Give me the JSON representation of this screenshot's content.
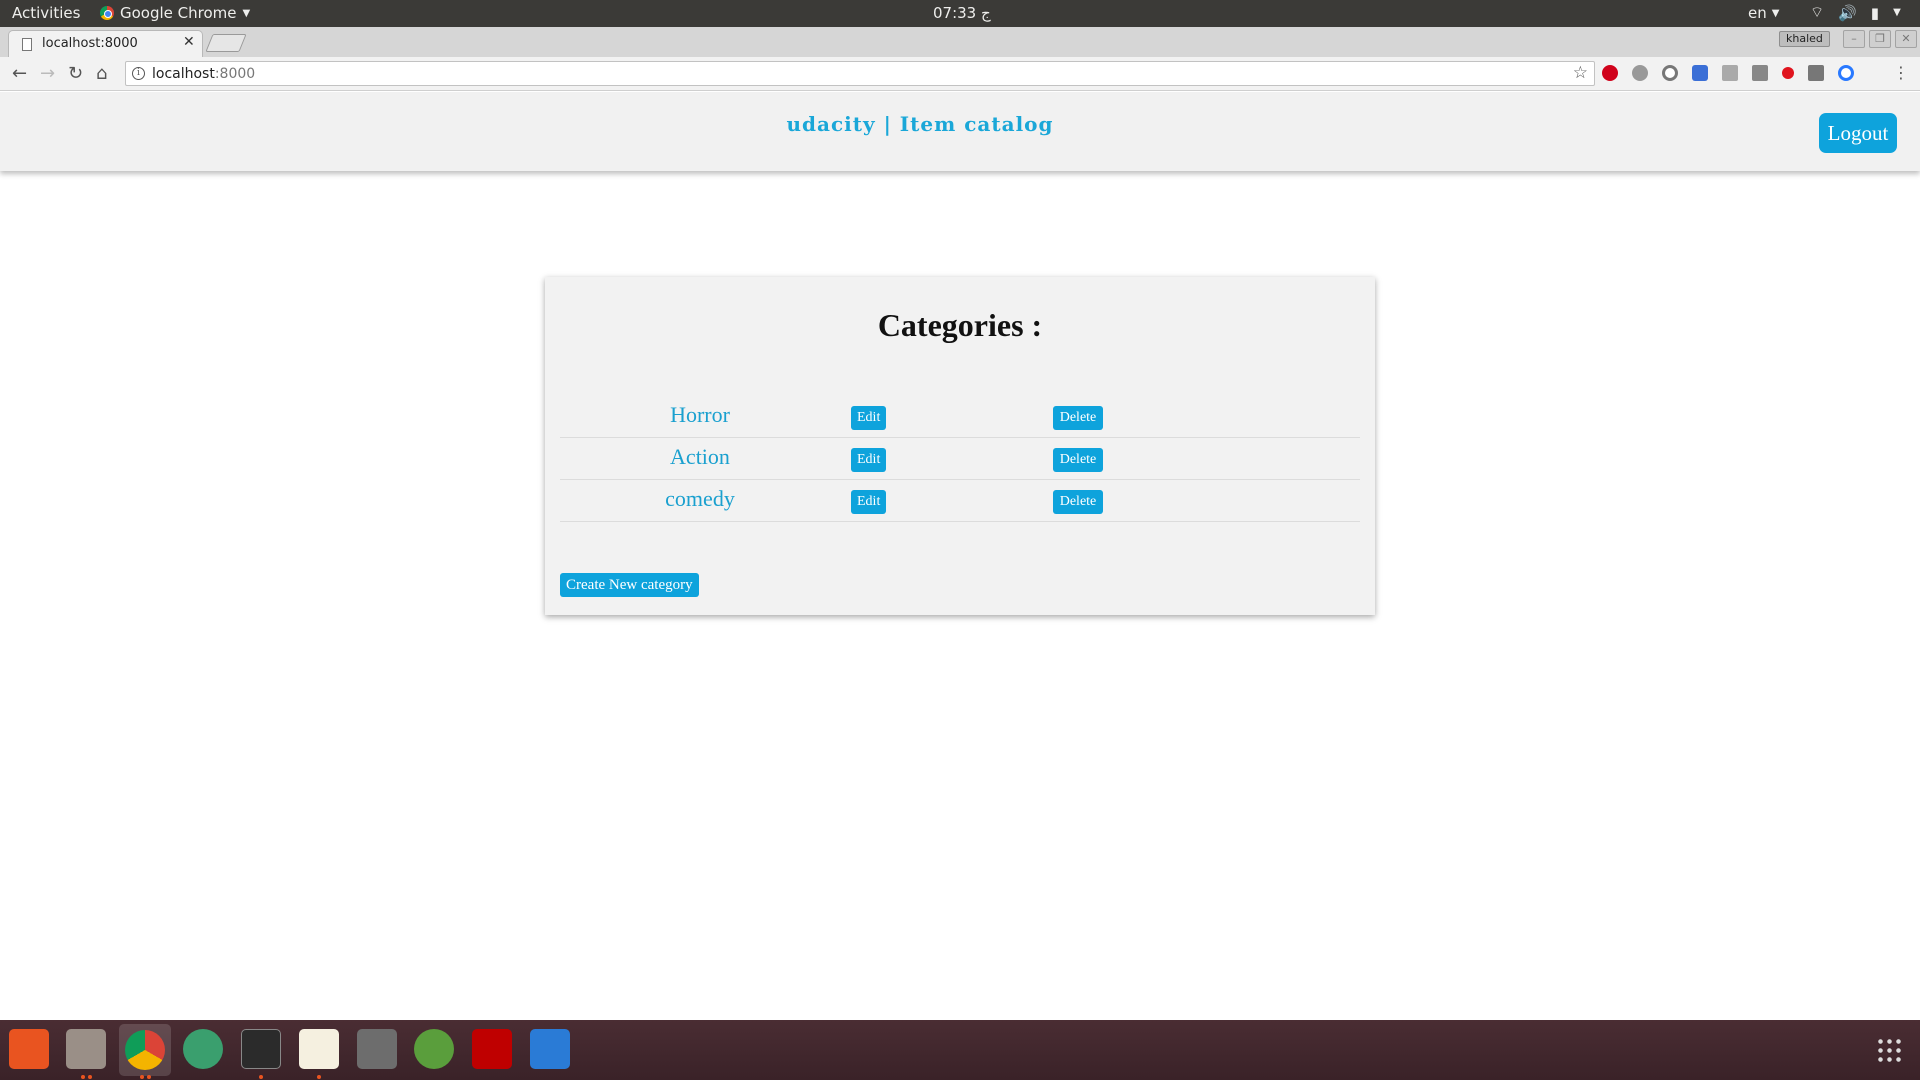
{
  "os_topbar": {
    "activities": "Activities",
    "app_name": "Google Chrome",
    "clock": "07:33 ج",
    "language": "en"
  },
  "browser": {
    "tab_title": "localhost:8000",
    "url_host": "localhost",
    "url_port": ":8000",
    "profile_name": "khaled",
    "extensions": [
      "adblock-icon",
      "extension-icon",
      "extension-icon",
      "extension-icon",
      "download-icon",
      "extension-icon",
      "record-icon",
      "camera-icon",
      "extension-icon"
    ]
  },
  "site": {
    "brand": "udacity | Item catalog",
    "logout_label": "Logout"
  },
  "catalog": {
    "title": "Categories :",
    "categories": [
      {
        "name": "Horror",
        "edit_label": "Edit",
        "delete_label": "Delete"
      },
      {
        "name": "Action",
        "edit_label": "Edit",
        "delete_label": "Delete"
      },
      {
        "name": "comedy",
        "edit_label": "Edit",
        "delete_label": "Delete"
      }
    ],
    "create_label": "Create New category"
  },
  "colors": {
    "accent": "#0ea3dc",
    "link": "#1aa0cf",
    "panel": "#f2f2f2"
  },
  "dock": {
    "apps": [
      "software-center-icon",
      "files-icon",
      "chrome-icon",
      "atom-icon",
      "terminal-icon",
      "text-editor-icon",
      "calculator-icon",
      "android-studio-icon",
      "filezilla-icon",
      "system-monitor-icon",
      "show-apps-icon"
    ]
  }
}
